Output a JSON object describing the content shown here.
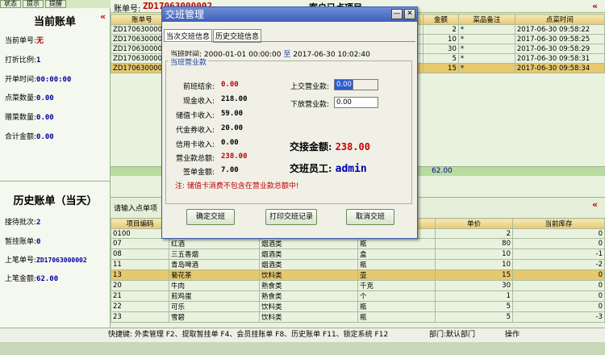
{
  "top_tabs": [
    "状态",
    "提示",
    "提醒"
  ],
  "current_bill": {
    "title": "当前账单",
    "fields": [
      {
        "label": "当前单号:",
        "value": "无"
      },
      {
        "label": "打折比例:",
        "value": "1"
      },
      {
        "label": "开单时间:",
        "value": "00:00:00"
      },
      {
        "label": "点菜数量:",
        "value": "0.00"
      },
      {
        "label": "赠菜数量:",
        "value": "0.00"
      },
      {
        "label": "合计金额:",
        "value": "0.00"
      }
    ]
  },
  "history_bill": {
    "title": "历史账单（当天）",
    "fields": [
      {
        "label": "接待批次:",
        "value": "2"
      },
      {
        "label": "暂挂账单:",
        "value": "0"
      },
      {
        "label": "上笔单号:",
        "value": "ZD17063000002"
      },
      {
        "label": "上笔金额:",
        "value": "62.00"
      }
    ]
  },
  "top_bar": {
    "bill_label": "账单号:",
    "bill_no": "ZD17063000002",
    "right_title": "客户已点项目"
  },
  "ordered_table": {
    "headers": [
      "账单号",
      "",
      "金额",
      "菜品备注",
      "点菜时间"
    ],
    "rows": [
      {
        "bill": "ZD17063000002",
        "amount": "2",
        "note": "*",
        "time": "2017-06-30 09:58:22"
      },
      {
        "bill": "ZD17063000002",
        "amount": "10",
        "note": "*",
        "time": "2017-06-30 09:58:25"
      },
      {
        "bill": "ZD17063000002",
        "amount": "30",
        "note": "*",
        "time": "2017-06-30 09:58:29"
      },
      {
        "bill": "ZD17063000002",
        "amount": "5",
        "note": "*",
        "time": "2017-06-30 09:58:31"
      },
      {
        "bill": "ZD17063000002",
        "amount": "15",
        "note": "*",
        "time": "2017-06-30 09:58:34"
      }
    ],
    "total": "62.00"
  },
  "lower_section": {
    "input_prompt": "请输入点单项"
  },
  "item_table": {
    "headers": [
      "项目编码",
      "",
      "",
      "",
      "单价",
      "当前库存"
    ],
    "rows": [
      {
        "code": "0100",
        "name": "",
        "cat": "",
        "unit": "",
        "price": "2",
        "stock": "0"
      },
      {
        "code": "07",
        "name": "红酒",
        "cat": "烟酒类",
        "unit": "瓶",
        "price": "80",
        "stock": "0"
      },
      {
        "code": "08",
        "name": "三五香烟",
        "cat": "烟酒类",
        "unit": "盒",
        "price": "10",
        "stock": "-1"
      },
      {
        "code": "11",
        "name": "青岛啤酒",
        "cat": "烟酒类",
        "unit": "瓶",
        "price": "10",
        "stock": "-2"
      },
      {
        "code": "13",
        "name": "菊花茶",
        "cat": "饮料类",
        "unit": "壶",
        "price": "15",
        "stock": "0"
      },
      {
        "code": "20",
        "name": "牛肉",
        "cat": "熟食类",
        "unit": "千克",
        "price": "30",
        "stock": "0"
      },
      {
        "code": "21",
        "name": "煎鸡蛋",
        "cat": "熟食类",
        "unit": "个",
        "price": "1",
        "stock": "0"
      },
      {
        "code": "22",
        "name": "可乐",
        "cat": "饮料类",
        "unit": "瓶",
        "price": "5",
        "stock": "0"
      },
      {
        "code": "23",
        "name": "雪碧",
        "cat": "饮料类",
        "unit": "瓶",
        "price": "5",
        "stock": "-3"
      }
    ]
  },
  "status_bar": {
    "shortcuts": "快捷键: 外卖管理 F2、提取暂挂单 F4、会员挂账单 F8、历史账单 F11、锁定系统 F12",
    "dept": "部门:默认部门",
    "op": "操作"
  },
  "dialog": {
    "title": "交班管理",
    "tabs": [
      "当次交班信息",
      "历史交班信息"
    ],
    "shift_time_label": "当班时间:",
    "shift_start": "2000-01-01 00:00:00",
    "shift_to": "至",
    "shift_end": "2017-06-30 10:02:40",
    "group_title": "当班营业款",
    "fields": [
      {
        "label": "前班结余:",
        "value": "0.00"
      },
      {
        "label": "现金收入:",
        "value": "218.00"
      },
      {
        "label": "储值卡收入:",
        "value": "59.00"
      },
      {
        "label": "代金券收入:",
        "value": "20.00"
      },
      {
        "label": "信用卡收入:",
        "value": "0.00"
      },
      {
        "label": "营业款总额:",
        "value": "238.00"
      },
      {
        "label": "签单金额:",
        "value": "7.00"
      }
    ],
    "handin_label": "上交营业款:",
    "handin_value": "0.00",
    "release_label": "下放营业款:",
    "release_value": "0.00",
    "handover_amount_label": "交接金额:",
    "handover_amount": "238.00",
    "staff_label": "交班员工:",
    "staff": "admin",
    "note": "注: 储值卡消费不包含在营业款总额中!",
    "buttons": [
      "确定交班",
      "打印交班记录",
      "取消交班"
    ]
  }
}
